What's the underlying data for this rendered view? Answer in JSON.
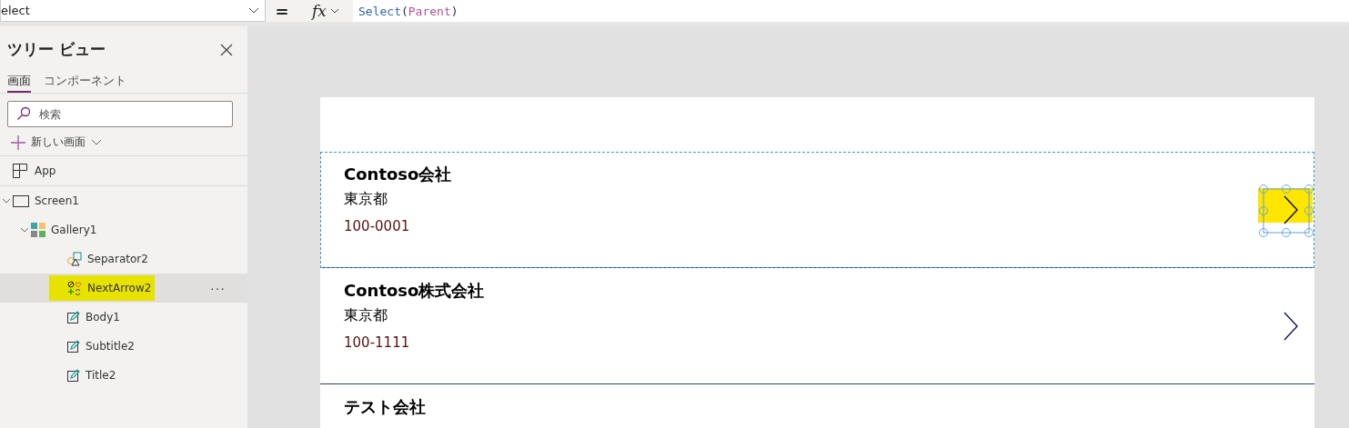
{
  "formula_bar": {
    "property_dropdown": "elect",
    "equals": "=",
    "fx_label": "fx",
    "formula": [
      {
        "text": "Select",
        "kind": "function"
      },
      {
        "text": "(",
        "kind": "punct"
      },
      {
        "text": "Parent",
        "kind": "identifier"
      },
      {
        "text": ")",
        "kind": "punct"
      }
    ]
  },
  "tree_view": {
    "title": "ツリー ビュー",
    "tabs": [
      {
        "label": "画面",
        "selected": true
      },
      {
        "label": "コンポーネント",
        "selected": false
      }
    ],
    "search": {
      "placeholder": "検索"
    },
    "new_screen": "新しい画面",
    "app_item": "App",
    "items": [
      {
        "label": "Screen1",
        "kind": "screen",
        "expanded": true,
        "selected": false,
        "highlighted": false,
        "children": [
          {
            "label": "Gallery1",
            "kind": "gallery",
            "expanded": true,
            "selected": false,
            "highlighted": false,
            "children": [
              {
                "label": "Separator2",
                "kind": "separator",
                "selected": false,
                "highlighted": false
              },
              {
                "label": "NextArrow2",
                "kind": "icon",
                "selected": true,
                "highlighted": true,
                "more": "···"
              },
              {
                "label": "Body1",
                "kind": "label",
                "selected": false,
                "highlighted": false
              },
              {
                "label": "Subtitle2",
                "kind": "label",
                "selected": false,
                "highlighted": false
              },
              {
                "label": "Title2",
                "kind": "label",
                "selected": false,
                "highlighted": false
              }
            ]
          }
        ]
      }
    ]
  },
  "gallery": {
    "items": [
      {
        "title": "Contoso会社",
        "subtitle": "東京都",
        "body": "100-0001",
        "selected": true,
        "highlighted": true
      },
      {
        "title": "Contoso株式会社",
        "subtitle": "東京都",
        "body": "100-1111",
        "selected": false,
        "highlighted": false
      },
      {
        "title": "テスト会社",
        "selected": false,
        "highlighted": false
      }
    ]
  }
}
